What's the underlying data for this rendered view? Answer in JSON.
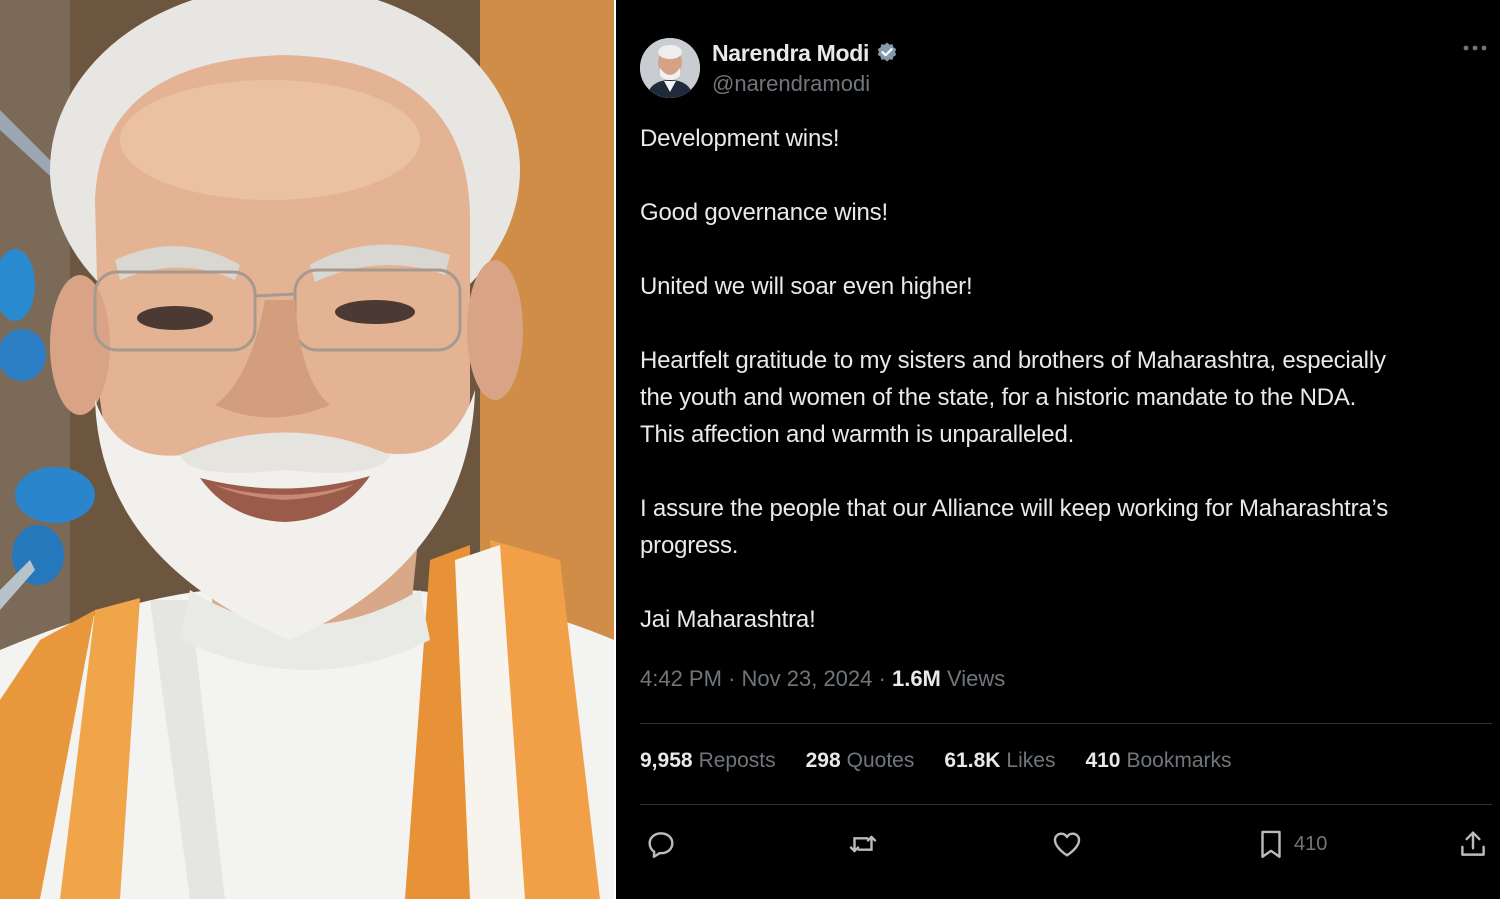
{
  "tweet": {
    "author": {
      "display_name": "Narendra Modi",
      "handle": "@narendramodi",
      "verified_icon": "verified-badge-icon"
    },
    "paragraphs": [
      "Development wins!",
      "Good governance wins!",
      "United we will soar even higher!",
      "Heartfelt gratitude to my sisters and brothers of Maharashtra, especially\nthe youth and women of the state, for a historic mandate to the NDA.\nThis affection and warmth is unparalleled.",
      "I assure the people that our Alliance will keep working for Maharashtra’s\nprogress.",
      "Jai Maharashtra!"
    ],
    "meta": {
      "time": "4:42 PM",
      "separator": "·",
      "date": "Nov 23, 2024",
      "views_count": "1.6M",
      "views_label": "Views"
    },
    "stats": {
      "reposts": {
        "count": "9,958",
        "label": "Reposts"
      },
      "quotes": {
        "count": "298",
        "label": "Quotes"
      },
      "likes": {
        "count": "61.8K",
        "label": "Likes"
      },
      "bookmarks": {
        "count": "410",
        "label": "Bookmarks"
      }
    },
    "actions": {
      "reply_icon": "reply-icon",
      "repost_icon": "repost-icon",
      "like_icon": "heart-icon",
      "bookmark_icon": "bookmark-icon",
      "bookmark_count": "410",
      "share_icon": "share-icon"
    }
  },
  "colors": {
    "background": "#000000",
    "text_primary": "#e7e9ea",
    "text_secondary": "#71767b",
    "verified": "#829aab",
    "divider": "#2f3336"
  }
}
